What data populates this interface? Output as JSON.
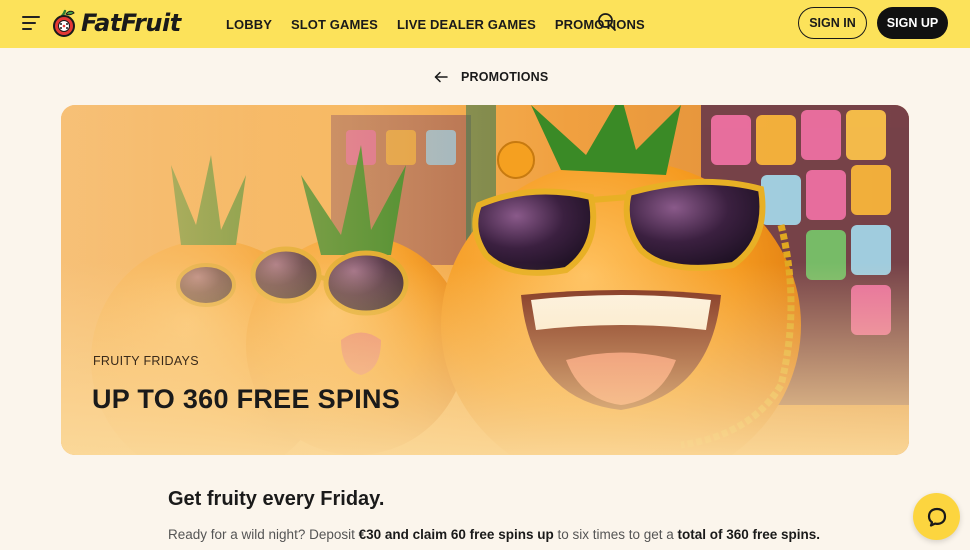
{
  "header": {
    "logo_text": "FatFruit",
    "nav": [
      "LOBBY",
      "SLOT GAMES",
      "LIVE DEALER GAMES",
      "PROMOTIONS"
    ],
    "sign_in": "SIGN IN",
    "sign_up": "SIGN UP"
  },
  "breadcrumb": {
    "label": "PROMOTIONS"
  },
  "hero": {
    "eyebrow": "FRUITY FRIDAYS",
    "title": "UP TO 360 FREE SPINS"
  },
  "content": {
    "heading": "Get fruity every Friday.",
    "para_1": "Ready for a wild night? Deposit ",
    "para_2": "€30 and claim 60 free spins up",
    "para_3": " to six times to get a ",
    "para_4": "total of 360 free spins."
  },
  "colors": {
    "header_bg": "#fce25a",
    "page_bg": "#fbf5ec",
    "accent_dark": "#111111",
    "chat_bg": "#fcd53f"
  },
  "icons": [
    "menu-icon",
    "fruit-logo-icon",
    "search-icon",
    "arrow-left-icon",
    "chat-icon"
  ]
}
